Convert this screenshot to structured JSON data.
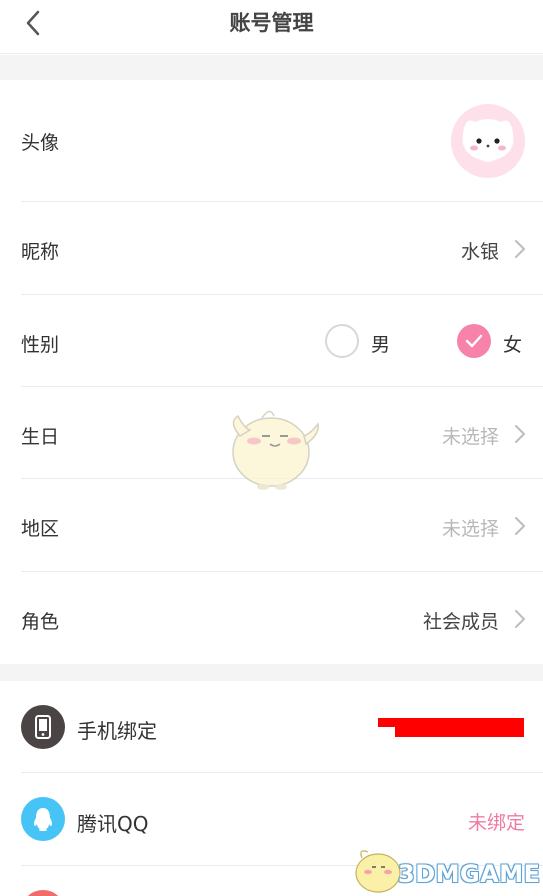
{
  "header": {
    "title": "账号管理",
    "back_icon": "chevron-left-icon"
  },
  "profile": {
    "avatar_label": "头像",
    "nickname_label": "昵称",
    "nickname_value": "水银",
    "gender_label": "性别",
    "gender_options": [
      "男",
      "女"
    ],
    "gender_selected": "女",
    "birthday_label": "生日",
    "birthday_value": "未选择",
    "region_label": "地区",
    "region_value": "未选择",
    "role_label": "角色",
    "role_value": "社会成员"
  },
  "bindings": {
    "phone_label": "手机绑定",
    "qq_label": "腾讯QQ",
    "qq_value": "未绑定"
  },
  "watermark": {
    "brand": "3DMGAME"
  },
  "colors": {
    "accent_pink": "#f783ab",
    "phone_icon_bg": "#4a4444",
    "qq_icon_bg": "#45c4f5",
    "redaction": "#ff0000"
  }
}
